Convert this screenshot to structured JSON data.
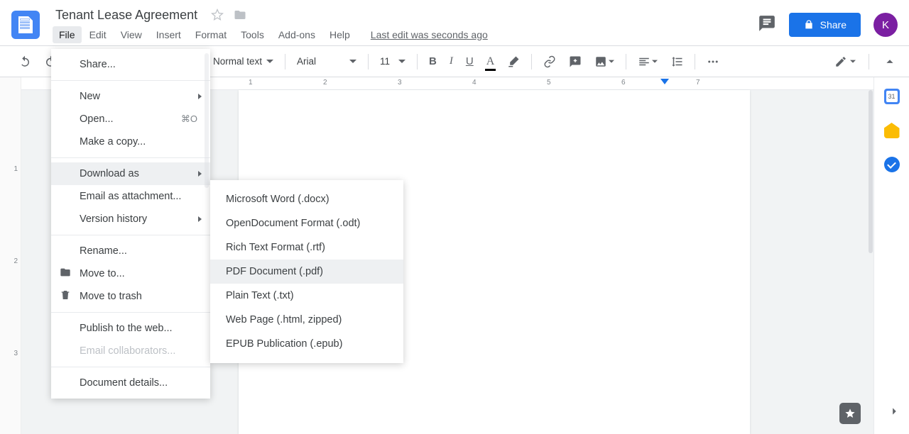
{
  "doc": {
    "title": "Tenant Lease Agreement"
  },
  "menus": {
    "file": "File",
    "edit": "Edit",
    "view": "View",
    "insert": "Insert",
    "format": "Format",
    "tools": "Tools",
    "addons": "Add-ons",
    "help": "Help",
    "last_edit": "Last edit was seconds ago"
  },
  "header": {
    "share": "Share",
    "avatar_initial": "K"
  },
  "toolbar": {
    "style": "Normal text",
    "font": "Arial",
    "size": "11"
  },
  "ruler": {
    "h": [
      "1",
      "2",
      "3",
      "4",
      "5",
      "6",
      "7"
    ],
    "v": [
      "1",
      "2",
      "3"
    ]
  },
  "file_menu": {
    "share": "Share...",
    "new": "New",
    "open": "Open...",
    "open_kbd": "⌘O",
    "copy": "Make a copy...",
    "download": "Download as",
    "email": "Email as attachment...",
    "version": "Version history",
    "rename": "Rename...",
    "move": "Move to...",
    "trash": "Move to trash",
    "publish": "Publish to the web...",
    "email_collab": "Email collaborators...",
    "details": "Document details..."
  },
  "download_sub": {
    "docx": "Microsoft Word (.docx)",
    "odt": "OpenDocument Format (.odt)",
    "rtf": "Rich Text Format (.rtf)",
    "pdf": "PDF Document (.pdf)",
    "txt": "Plain Text (.txt)",
    "html": "Web Page (.html, zipped)",
    "epub": "EPUB Publication (.epub)"
  }
}
